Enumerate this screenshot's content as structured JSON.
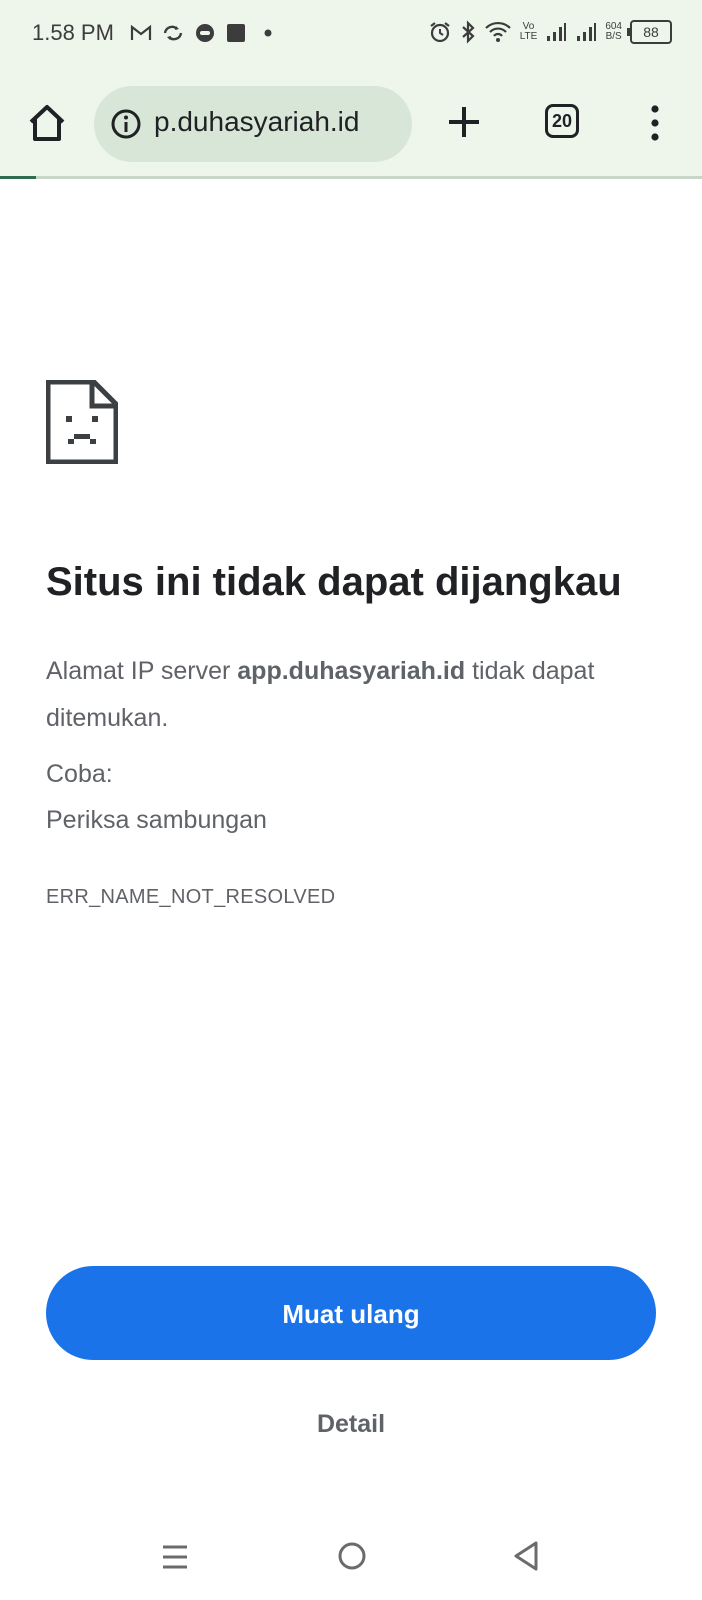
{
  "status_bar": {
    "time": "1.58 PM",
    "left_icons": [
      "gmail-icon",
      "sync-icon",
      "messenger-icon",
      "app-icon",
      "dot-icon"
    ],
    "right_icons": [
      "alarm-icon",
      "bluetooth-icon",
      "wifi-icon",
      "volte-icon",
      "signal-icon",
      "signal-icon"
    ],
    "volte_label_top": "Vo",
    "volte_label_bottom": "LTE",
    "net_speed_value": "604",
    "net_speed_unit": "B/S",
    "battery": "88"
  },
  "toolbar": {
    "url": "p.duhasyariah.id",
    "tab_count": "20"
  },
  "error_page": {
    "title": "Situs ini tidak dapat dijangkau",
    "desc_prefix": "Alamat IP server ",
    "desc_host": "app.duhasyariah.id",
    "desc_suffix": " tidak dapat ditemukan.",
    "try_label": "Coba:",
    "suggestion": "Periksa sambungan",
    "error_code": "ERR_NAME_NOT_RESOLVED",
    "reload_label": "Muat ulang",
    "detail_label": "Detail"
  },
  "colors": {
    "accent": "#1a73e8",
    "toolbar_bg": "#eef6ec",
    "omnibox_bg": "#d8e6d8"
  }
}
